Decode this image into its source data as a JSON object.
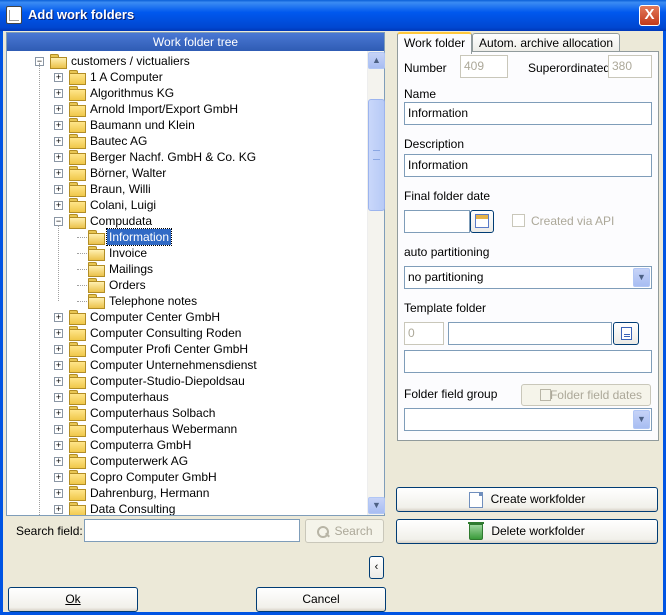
{
  "window": {
    "title": "Add work folders",
    "close_symbol": "X"
  },
  "tree": {
    "header": "Work folder tree",
    "items": [
      {
        "label": "customers / victualiers",
        "level": 0,
        "expander": "minus"
      },
      {
        "label": "1 A Computer",
        "level": 1,
        "expander": "plus"
      },
      {
        "label": "Algorithmus KG",
        "level": 1,
        "expander": "plus"
      },
      {
        "label": "Arnold Import/Export GmbH",
        "level": 1,
        "expander": "plus"
      },
      {
        "label": "Baumann und Klein",
        "level": 1,
        "expander": "plus"
      },
      {
        "label": "Bautec AG",
        "level": 1,
        "expander": "plus"
      },
      {
        "label": "Berger Nachf. GmbH & Co. KG",
        "level": 1,
        "expander": "plus"
      },
      {
        "label": "Börner, Walter",
        "level": 1,
        "expander": "plus"
      },
      {
        "label": "Braun, Willi",
        "level": 1,
        "expander": "plus"
      },
      {
        "label": "Colani, Luigi",
        "level": 1,
        "expander": "plus"
      },
      {
        "label": "Compudata",
        "level": 1,
        "expander": "minus"
      },
      {
        "label": "Information",
        "level": 2,
        "expander": "",
        "selected": true
      },
      {
        "label": "Invoice",
        "level": 2,
        "expander": ""
      },
      {
        "label": "Mailings",
        "level": 2,
        "expander": ""
      },
      {
        "label": "Orders",
        "level": 2,
        "expander": ""
      },
      {
        "label": "Telephone notes",
        "level": 2,
        "expander": ""
      },
      {
        "label": "Computer Center GmbH",
        "level": 1,
        "expander": "plus"
      },
      {
        "label": "Computer Consulting Roden",
        "level": 1,
        "expander": "plus"
      },
      {
        "label": "Computer Profi Center GmbH",
        "level": 1,
        "expander": "plus"
      },
      {
        "label": "Computer Unternehmensdienst",
        "level": 1,
        "expander": "plus"
      },
      {
        "label": "Computer-Studio-Diepoldsau",
        "level": 1,
        "expander": "plus"
      },
      {
        "label": "Computerhaus",
        "level": 1,
        "expander": "plus"
      },
      {
        "label": "Computerhaus  Solbach",
        "level": 1,
        "expander": "plus"
      },
      {
        "label": "Computerhaus  Webermann",
        "level": 1,
        "expander": "plus"
      },
      {
        "label": "Computerra GmbH",
        "level": 1,
        "expander": "plus"
      },
      {
        "label": "Computerwerk AG",
        "level": 1,
        "expander": "plus"
      },
      {
        "label": "Copro Computer GmbH",
        "level": 1,
        "expander": "plus"
      },
      {
        "label": "Dahrenburg, Hermann",
        "level": 1,
        "expander": "plus"
      },
      {
        "label": "Data Consulting",
        "level": 1,
        "expander": "plus"
      }
    ]
  },
  "search": {
    "label": "Search field:",
    "value": "",
    "button": "Search"
  },
  "collapse_button": "‹",
  "ok_button": "Ok",
  "cancel_button": "Cancel",
  "tabs": [
    {
      "label": "Work folder",
      "active": true
    },
    {
      "label": "Autom. archive allocation",
      "active": false
    }
  ],
  "form": {
    "number_label": "Number",
    "number_value": "409",
    "superordinated_label": "Superordinated",
    "superordinated_value": "380",
    "name_label": "Name",
    "name_value": "Information",
    "description_label": "Description",
    "description_value": "Information",
    "final_date_label": "Final folder date",
    "final_date_value": "",
    "created_via_api_label": "Created via API",
    "auto_partitioning_label": "auto partitioning",
    "auto_partitioning_value": "no partitioning",
    "template_folder_label": "Template folder",
    "template_folder_id": "0",
    "template_folder_name": "",
    "template_folder_path": "",
    "field_group_label": "Folder field group",
    "field_dates_button": "Folder field dates",
    "field_group_value": ""
  },
  "create_button": "Create workfolder",
  "delete_button": "Delete workfolder"
}
